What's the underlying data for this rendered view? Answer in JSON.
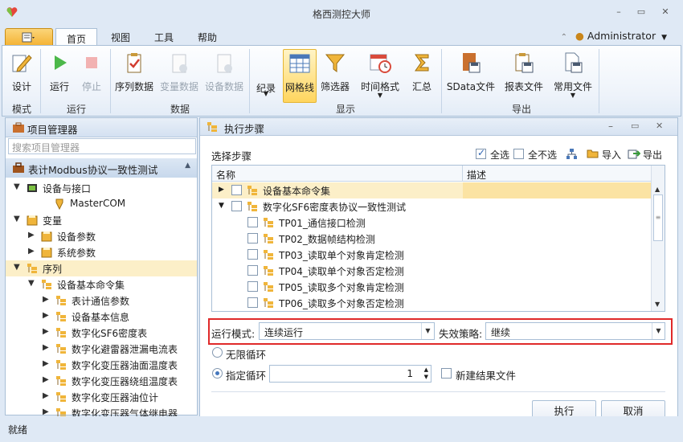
{
  "window": {
    "title": "格西测控大师",
    "minimize": "–",
    "restore": "▭",
    "close": "✕"
  },
  "ribbon_tabs": [
    "首页",
    "视图",
    "工具",
    "帮助"
  ],
  "user": "Administrator",
  "ribbon": {
    "buttons": {
      "design": "设计",
      "run": "运行",
      "stop": "停止",
      "seq_data": "序列数据",
      "var_data": "变量数据",
      "dev_data": "设备数据",
      "record": "纪录",
      "grid": "网格线",
      "filter": "筛选器",
      "time_format": "时间格式",
      "summary": "汇总",
      "sdata_file": "SData文件",
      "report_file": "报表文件",
      "common_file": "常用文件"
    },
    "groups": {
      "mode": "模式",
      "run": "运行",
      "data": "数据",
      "display": "显示",
      "export": "导出"
    }
  },
  "left_panel": {
    "title": "项目管理器",
    "search_placeholder": "搜索项目管理器",
    "project": "表计Modbus协议一致性测试",
    "tree": [
      {
        "label": "设备与接口"
      },
      {
        "label": "MasterCOM"
      },
      {
        "label": "变量"
      },
      {
        "label": "设备参数"
      },
      {
        "label": "系统参数"
      },
      {
        "label": "序列"
      },
      {
        "label": "设备基本命令集"
      },
      {
        "label": "表计通信参数"
      },
      {
        "label": "设备基本信息"
      },
      {
        "label": "数字化SF6密度表"
      },
      {
        "label": "数字化避雷器泄漏电流表"
      },
      {
        "label": "数字化变压器油面温度表"
      },
      {
        "label": "数字化变压器绕组温度表"
      },
      {
        "label": "数字化变压器油位计"
      },
      {
        "label": "数字化变压器气体继电器"
      }
    ]
  },
  "status": "就绪",
  "dialog": {
    "title": "执行步骤",
    "section": "选择步骤",
    "select_all": "全选",
    "deselect_all": "全不选",
    "import": "导入",
    "export": "导出",
    "columns": {
      "name": "名称",
      "desc": "描述"
    },
    "rows": [
      {
        "label": "设备基本命令集"
      },
      {
        "label": "数字化SF6密度表协议一致性测试"
      },
      {
        "label": "TP01_通信接口检测"
      },
      {
        "label": "TP02_数据帧结构检测"
      },
      {
        "label": "TP03_读取单个对象肯定检测"
      },
      {
        "label": "TP04_读取单个对象否定检测"
      },
      {
        "label": "TP05_读取多个对象肯定检测"
      },
      {
        "label": "TP06_读取多个对象否定检测"
      }
    ],
    "run_mode_label": "运行模式:",
    "run_mode_value": "连续运行",
    "fail_policy_label": "失效策略:",
    "fail_policy_value": "继续",
    "infinite_loop": "无限循环",
    "fixed_loop": "指定循环",
    "loop_count": "1",
    "new_result_file": "新建结果文件",
    "execute": "执行",
    "cancel": "取消"
  },
  "colors": {
    "highlight_border": "#e02a2a",
    "selected_row": "#fcefc8",
    "accent": "#2d64b3"
  }
}
